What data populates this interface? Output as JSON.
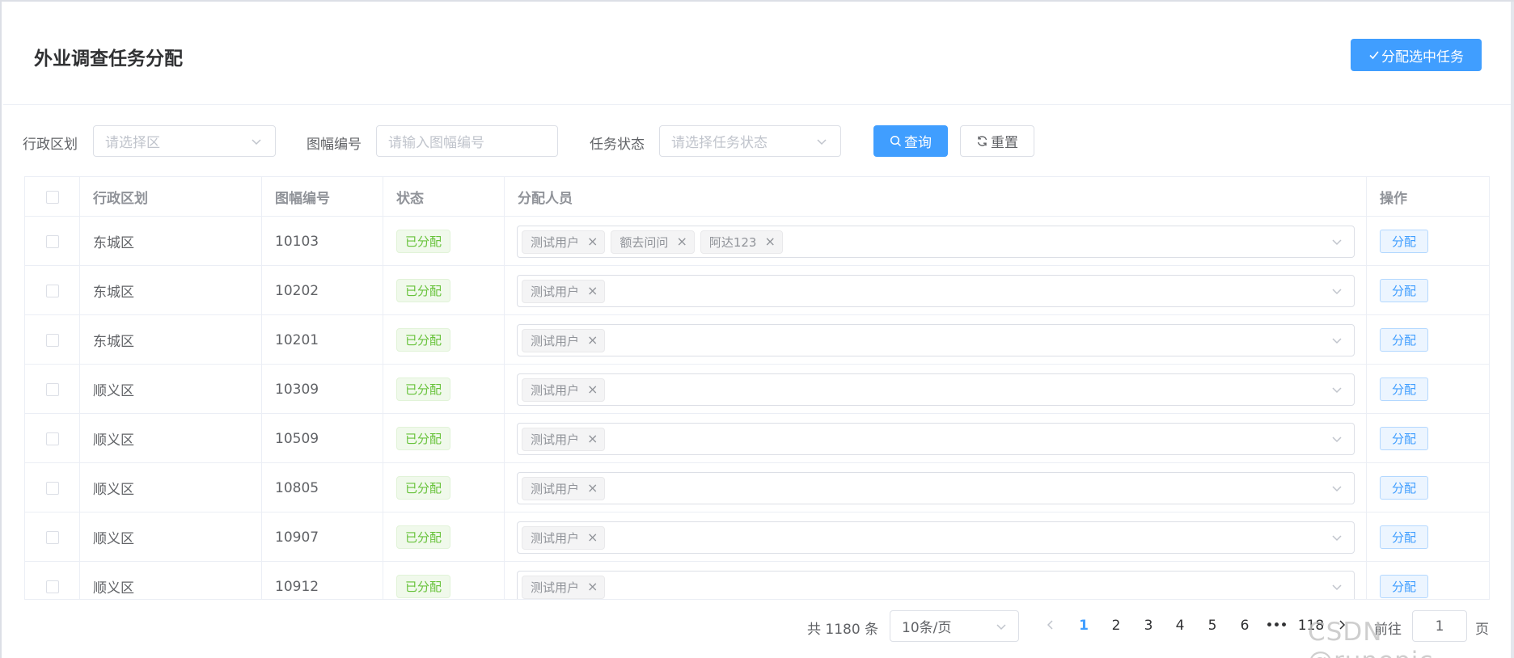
{
  "header": {
    "title": "外业调查任务分配",
    "assign_selected_label": "分配选中任务"
  },
  "filters": {
    "district_label": "行政区划",
    "district_placeholder": "请选择区",
    "sheet_label": "图幅编号",
    "sheet_placeholder": "请输入图幅编号",
    "status_label": "任务状态",
    "status_placeholder": "请选择任务状态",
    "query_label": "查询",
    "reset_label": "重置"
  },
  "table": {
    "columns": [
      "行政区划",
      "图幅编号",
      "状态",
      "分配人员",
      "操作"
    ],
    "rows": [
      {
        "district": "东城区",
        "sheet": "10103",
        "status": "已分配",
        "users": [
          "测试用户",
          "额去问问",
          "阿达123"
        ],
        "action": "分配"
      },
      {
        "district": "东城区",
        "sheet": "10202",
        "status": "已分配",
        "users": [
          "测试用户"
        ],
        "action": "分配"
      },
      {
        "district": "东城区",
        "sheet": "10201",
        "status": "已分配",
        "users": [
          "测试用户"
        ],
        "action": "分配"
      },
      {
        "district": "顺义区",
        "sheet": "10309",
        "status": "已分配",
        "users": [
          "测试用户"
        ],
        "action": "分配"
      },
      {
        "district": "顺义区",
        "sheet": "10509",
        "status": "已分配",
        "users": [
          "测试用户"
        ],
        "action": "分配"
      },
      {
        "district": "顺义区",
        "sheet": "10805",
        "status": "已分配",
        "users": [
          "测试用户"
        ],
        "action": "分配"
      },
      {
        "district": "顺义区",
        "sheet": "10907",
        "status": "已分配",
        "users": [
          "测试用户"
        ],
        "action": "分配"
      },
      {
        "district": "顺义区",
        "sheet": "10912",
        "status": "已分配",
        "users": [
          "测试用户"
        ],
        "action": "分配"
      }
    ]
  },
  "pagination": {
    "total_text": "共 1180 条",
    "page_size": "10条/页",
    "pages": [
      "1",
      "2",
      "3",
      "4",
      "5",
      "6"
    ],
    "ellipsis": "•••",
    "last_page": "118",
    "active_page": "1",
    "goto_label": "前往",
    "goto_value": "1",
    "page_suffix": "页"
  },
  "watermark": "CSDN @runepic",
  "colors": {
    "primary": "#409eff",
    "success_text": "#67c23a",
    "success_bg": "#f0f9eb"
  }
}
